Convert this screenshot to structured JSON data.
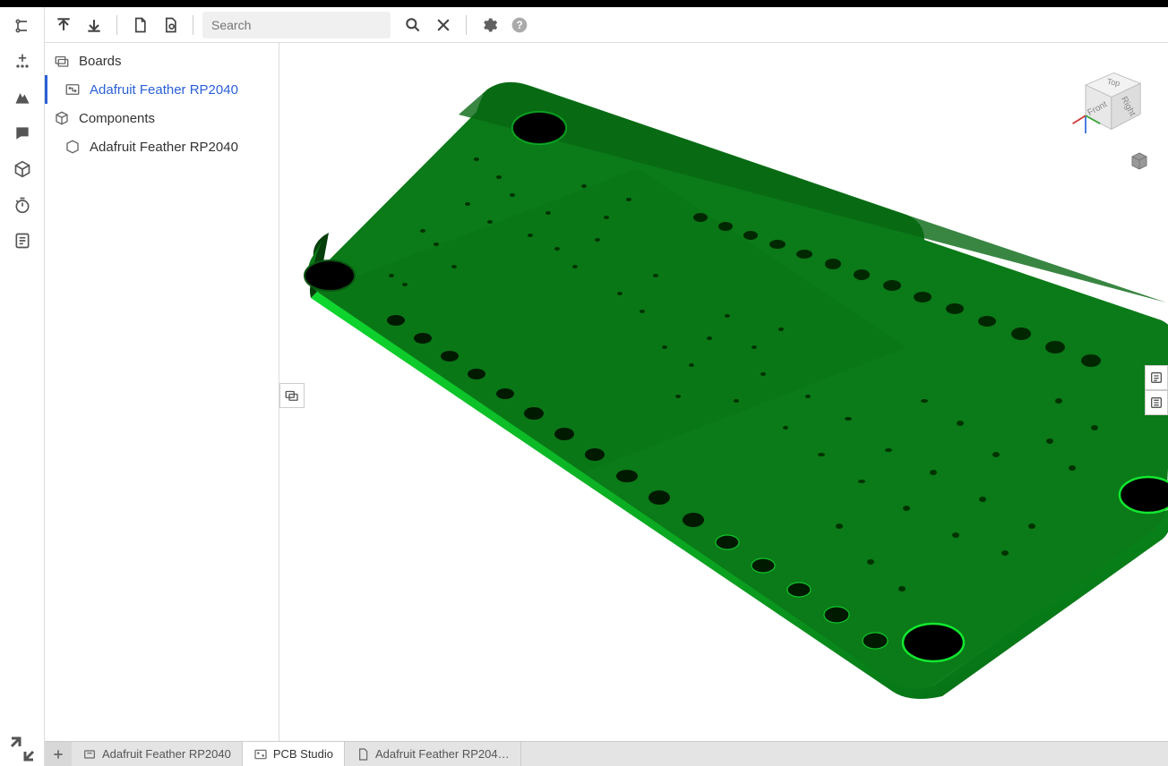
{
  "toolbar": {
    "search_placeholder": "Search"
  },
  "tree": {
    "boards_label": "Boards",
    "board_item": "Adafruit Feather RP2040",
    "components_label": "Components",
    "component_item": "Adafruit Feather RP2040"
  },
  "viewcube": {
    "front": "Front",
    "top": "Top",
    "right": "Right"
  },
  "tabs": {
    "t1": "Adafruit Feather RP2040",
    "t2": "PCB Studio",
    "t3": "Adafruit Feather RP204…"
  }
}
